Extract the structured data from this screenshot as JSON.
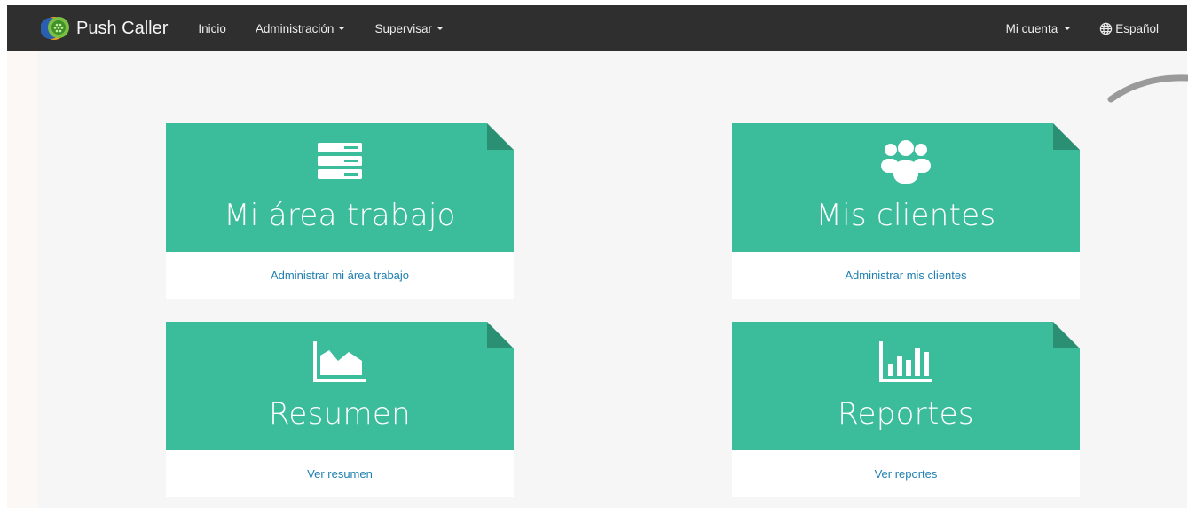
{
  "navbar": {
    "brand": "Push Caller",
    "items": [
      {
        "label": "Inicio"
      },
      {
        "label": "Administración"
      },
      {
        "label": "Supervisar"
      }
    ],
    "account": "Mi cuenta",
    "language": "Español"
  },
  "cards": [
    {
      "title": "Mi área trabajo",
      "link": "Administrar mi área trabajo",
      "icon": "server-stack-icon"
    },
    {
      "title": "Mis clientes",
      "link": "Administrar mis clientes",
      "icon": "users-group-icon"
    },
    {
      "title": "Resumen",
      "link": "Ver resumen",
      "icon": "area-chart-icon"
    },
    {
      "title": "Reportes",
      "link": "Ver reportes",
      "icon": "bar-chart-icon"
    }
  ],
  "colors": {
    "navbar": "#2f2f2f",
    "card_accent": "#3bbc9b",
    "link": "#1f7fb0"
  }
}
